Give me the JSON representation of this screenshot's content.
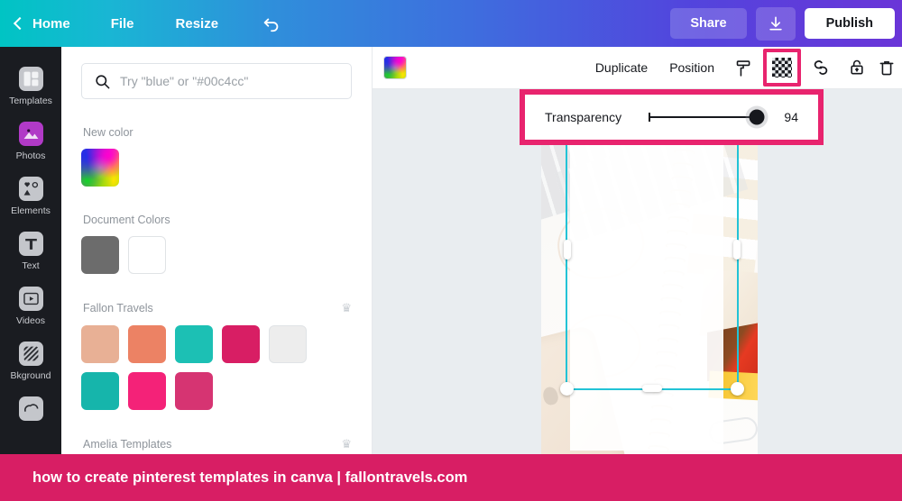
{
  "topbar": {
    "home_label": "Home",
    "file_label": "File",
    "resize_label": "Resize",
    "undo_icon": "undo-arrow-icon",
    "back_icon": "chevron-left-icon",
    "share_label": "Share",
    "download_icon": "download-icon",
    "publish_label": "Publish",
    "gradient_start": "#00c4c4",
    "gradient_end": "#6a35d8"
  },
  "sidebar": {
    "items": [
      {
        "label": "Templates",
        "icon": "templates-icon"
      },
      {
        "label": "Photos",
        "icon": "photos-icon"
      },
      {
        "label": "Elements",
        "icon": "elements-icon"
      },
      {
        "label": "Text",
        "icon": "text-icon"
      },
      {
        "label": "Videos",
        "icon": "videos-icon"
      },
      {
        "label": "Bkground",
        "icon": "background-icon"
      }
    ],
    "partial_item_icon": "uploads-icon",
    "background": "#1a1c21"
  },
  "panel": {
    "search": {
      "placeholder": "Try \"blue\" or \"#00c4cc\"",
      "value": "",
      "icon": "search-icon"
    },
    "new_color": {
      "title": "New color",
      "swatches": [
        {
          "name": "rainbow-picker",
          "color": "rainbow"
        }
      ]
    },
    "document_colors": {
      "title": "Document Colors",
      "swatches": [
        {
          "name": "gray",
          "color": "#6c6c6c"
        },
        {
          "name": "white",
          "color": "#ffffff"
        }
      ]
    },
    "brand_kits": [
      {
        "title": "Fallon Travels",
        "badge_icon": "crown-icon",
        "swatches": [
          {
            "name": "peach",
            "color": "#e8b095"
          },
          {
            "name": "coral",
            "color": "#ec8264"
          },
          {
            "name": "teal",
            "color": "#1cc0b4"
          },
          {
            "name": "magenta",
            "color": "#d81e64"
          },
          {
            "name": "off-white",
            "color": "#ededed"
          },
          {
            "name": "teal-dark",
            "color": "#16b5ab"
          },
          {
            "name": "pink",
            "color": "#f42278"
          },
          {
            "name": "rose",
            "color": "#d63472"
          }
        ]
      },
      {
        "title": "Amelia Templates",
        "badge_icon": "crown-icon",
        "swatches": []
      }
    ]
  },
  "objectbar": {
    "color_swatch": "rainbow",
    "duplicate_label": "Duplicate",
    "position_label": "Position",
    "icons": [
      {
        "name": "paint-roller-icon",
        "selected": false
      },
      {
        "name": "transparency-icon",
        "selected": true
      },
      {
        "name": "link-icon",
        "selected": false
      },
      {
        "name": "lock-icon",
        "selected": false
      },
      {
        "name": "trash-icon",
        "selected": false
      }
    ],
    "highlight_color": "#e8246e"
  },
  "transparency_popup": {
    "label": "Transparency",
    "value": 94,
    "min": 0,
    "max": 100,
    "border_color": "#e8246e"
  },
  "canvas": {
    "background": "#e9edf0",
    "selection_color": "#22c3d6",
    "comment_icon": "add-comment-icon",
    "photo_alt": "desk flatlay with keyboard notebook and phone"
  },
  "caption": {
    "text": "how to create pinterest templates in canva | fallontravels.com",
    "background": "#d81e64"
  }
}
